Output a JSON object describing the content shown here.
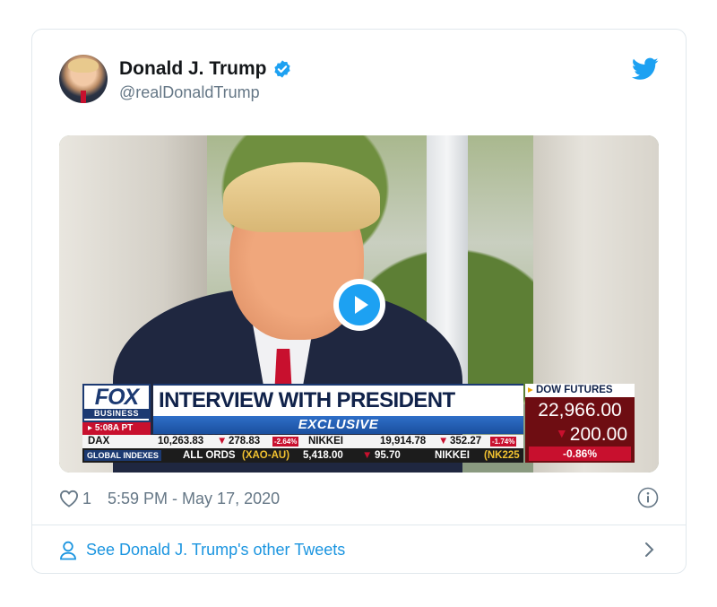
{
  "tweet": {
    "author": {
      "display_name": "Donald J. Trump",
      "handle": "@realDonaldTrump",
      "verified_icon": "verified-badge-icon"
    },
    "brand_icon": "twitter-bird-icon",
    "media": {
      "type": "video",
      "play_icon": "play-icon",
      "chyron": {
        "network": "FOX",
        "network_sub": "BUSINESS",
        "time": "5:08A PT",
        "headline": "INTERVIEW WITH PRESIDENT TRUMP",
        "tag": "EXCLUSIVE",
        "ticker_row1": {
          "dax_label": "DAX",
          "dax_value": "10,263.83",
          "dax_change": "278.83",
          "dax_pct": "-2.64%",
          "nikkei_label": "NIKKEI",
          "nikkei_value": "19,914.78",
          "nikkei_change": "352.27",
          "nikkei_pct": "-1.74%"
        },
        "ticker_row2": {
          "global_label": "GLOBAL INDEXES",
          "allords_label": "ALL ORDS",
          "allords_code": "(XAO-AU)",
          "allords_value": "5,418.00",
          "allords_change": "95.70",
          "nikkei_label": "NIKKEI",
          "nikkei_code": "(NK225"
        },
        "dow_futures": {
          "label": "DOW FUTURES",
          "value": "22,966.00",
          "change": "200.00",
          "pct": "-0.86%"
        }
      }
    },
    "likes": "1",
    "timestamp": "5:59 PM - May 17, 2020",
    "info_icon": "info-icon",
    "footer_link": "See Donald J. Trump's other Tweets"
  },
  "colors": {
    "link_blue": "#1b95e0",
    "twitter_blue": "#1da1f2",
    "muted_text": "#657786",
    "border": "#e1e8ed"
  }
}
